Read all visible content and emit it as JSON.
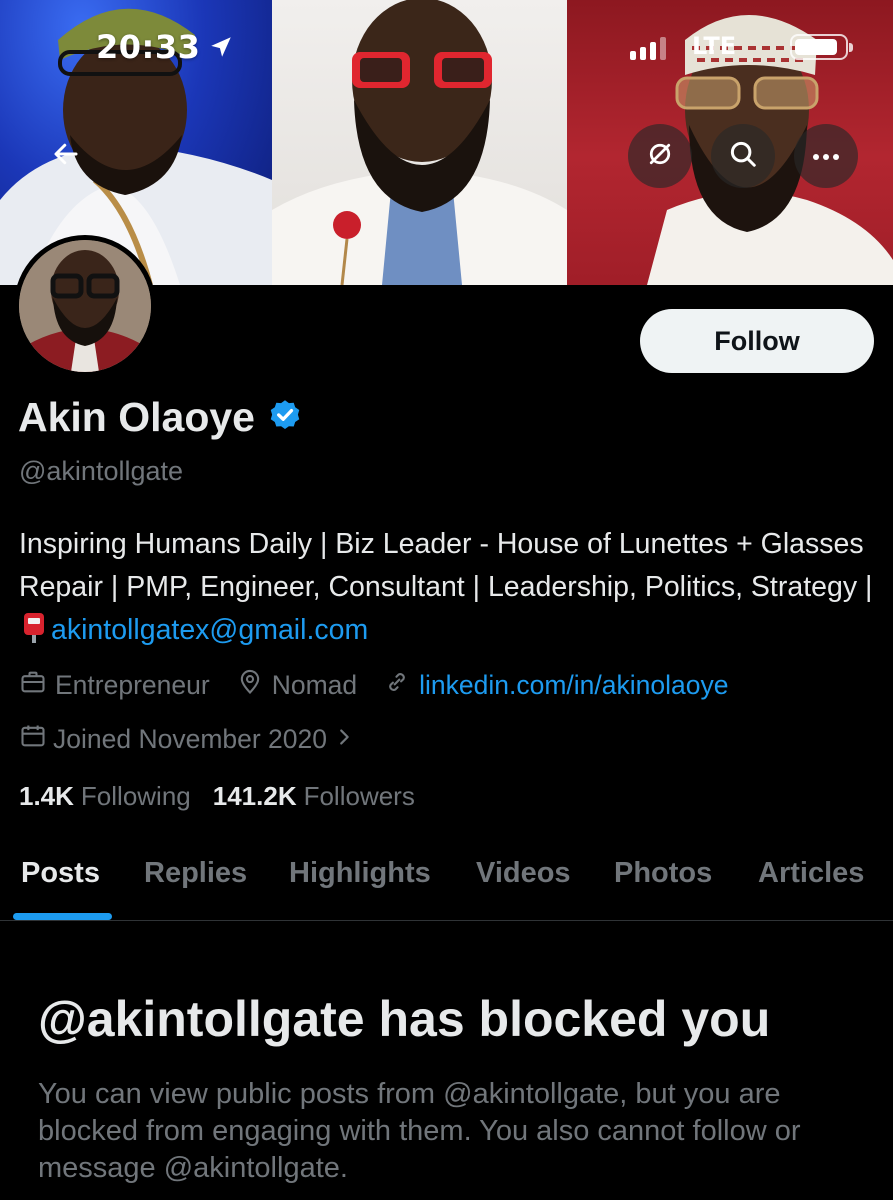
{
  "status_bar": {
    "time": "20:33",
    "network": "LTE",
    "location_icon": "location-arrow-icon",
    "signal_icon": "signal-bars-icon",
    "battery_icon": "battery-icon"
  },
  "nav": {
    "back_icon": "back-arrow-icon",
    "mute_icon": "mute-slash-icon",
    "search_icon": "search-icon",
    "more_icon": "more-dots-icon"
  },
  "profile": {
    "display_name": "Akin Olaoye",
    "verified_icon": "verified-badge-icon",
    "handle": "@akintollgate",
    "follow_label": "Follow",
    "bio_text": "Inspiring Humans Daily | Biz Leader - House of Lunettes + Glasses Repair | PMP, Engineer, Consultant | Leadership, Politics, Strategy |",
    "bio_email": "akintollgatex@gmail.com",
    "profession": "Entrepreneur",
    "location": "Nomad",
    "website": "linkedin.com/in/akinolaoye",
    "joined": "Joined November 2020",
    "following_count": "1.4K",
    "following_label": "Following",
    "followers_count": "141.2K",
    "followers_label": "Followers"
  },
  "tabs": [
    "Posts",
    "Replies",
    "Highlights",
    "Videos",
    "Photos",
    "Articles"
  ],
  "active_tab": "Posts",
  "blocked": {
    "title": "@akintollgate has blocked you",
    "description": "You can view public posts from @akintollgate, but you are blocked from engaging with them. You also cannot follow or message @akintollgate."
  },
  "colors": {
    "background": "#000000",
    "accent": "#1d9bf0",
    "primary_text": "#e7e9ea",
    "secondary_text": "#71767b",
    "follow_button": "#eff3f4"
  }
}
